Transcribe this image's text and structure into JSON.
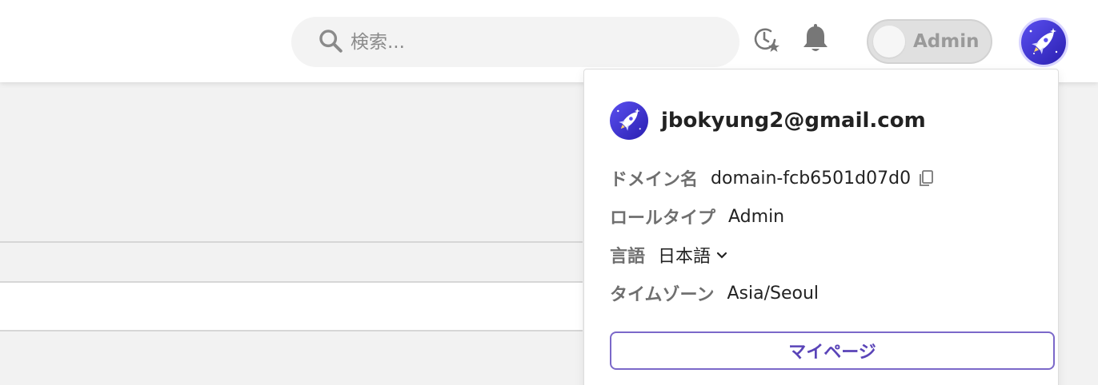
{
  "header": {
    "search": {
      "placeholder": "検索..."
    },
    "icons": [
      "search-icon",
      "history-star-icon",
      "bell-icon"
    ],
    "role_toggle": {
      "label": "Admin",
      "checked": false
    }
  },
  "profile_menu": {
    "email": "jbokyung2@gmail.com",
    "domain": {
      "label": "ドメイン名",
      "value": "domain-fcb6501d07d0"
    },
    "role": {
      "label": "ロールタイプ",
      "value": "Admin"
    },
    "language": {
      "label": "言語",
      "value": "日本語"
    },
    "timezone": {
      "label": "タイムゾーン",
      "value": "Asia/Seoul"
    },
    "mypage_button": "マイページ"
  },
  "colors": {
    "accent": "#5a44b8",
    "avatar_bg": "#3b2fd6",
    "icon_gray": "#777777"
  }
}
